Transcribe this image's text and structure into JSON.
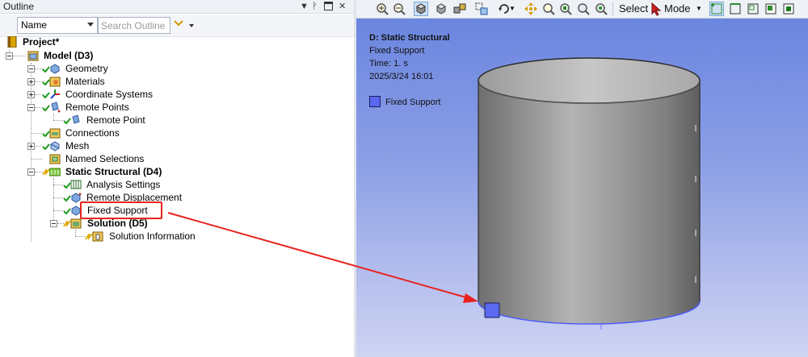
{
  "outline": {
    "title": "Outline",
    "filter": {
      "name_value": "Name",
      "search_placeholder": "Search Outline"
    },
    "tree": [
      {
        "label": "Project*",
        "bold": true
      },
      {
        "label": "Model (D3)",
        "bold": true
      },
      {
        "label": "Geometry",
        "bold": false
      },
      {
        "label": "Materials",
        "bold": false
      },
      {
        "label": "Coordinate Systems",
        "bold": false
      },
      {
        "label": "Remote Points",
        "bold": false
      },
      {
        "label": "Remote Point",
        "bold": false
      },
      {
        "label": "Connections",
        "bold": false
      },
      {
        "label": "Mesh",
        "bold": false
      },
      {
        "label": "Named Selections",
        "bold": false
      },
      {
        "label": "Static Structural (D4)",
        "bold": true
      },
      {
        "label": "Analysis Settings",
        "bold": false
      },
      {
        "label": "Remote Displacement",
        "bold": false
      },
      {
        "label": "Fixed Support",
        "bold": false
      },
      {
        "label": "Solution (D5)",
        "bold": true
      },
      {
        "label": "Solution Information",
        "bold": false
      }
    ]
  },
  "toolbar": {
    "select_label": "Select",
    "mode_label": "Mode"
  },
  "viewport": {
    "analysis_title": "D: Static Structural",
    "object_name": "Fixed Support",
    "time": "Time: 1. s",
    "date": "2025/3/24 16:01",
    "legend_label": "Fixed Support",
    "legend_color": "#5b68f0"
  },
  "colors": {
    "highlight": "#e8231f",
    "arrow": "#e8231f",
    "check": "#1a9a1a"
  }
}
